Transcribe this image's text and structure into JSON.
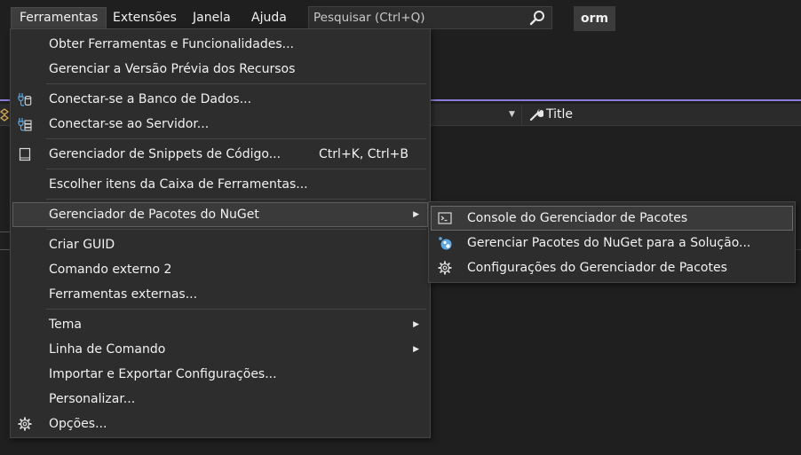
{
  "menubar": {
    "items": [
      {
        "label": "Ferramentas"
      },
      {
        "label": "Extensões"
      },
      {
        "label": "Janela"
      },
      {
        "label": "Ajuda"
      }
    ],
    "search_placeholder": "Pesquisar (Ctrl+Q)",
    "profile_badge": "orm"
  },
  "toolbar": {
    "title_label": "Title"
  },
  "tools_menu": {
    "items": [
      {
        "label": "Obter Ferramentas e Funcionalidades..."
      },
      {
        "label": "Gerenciar a Versão Prévia dos Recursos"
      },
      {
        "label": "Conectar-se a Banco de Dados...",
        "icon": "database-connect-icon"
      },
      {
        "label": "Conectar-se ao Servidor...",
        "icon": "server-connect-icon"
      },
      {
        "label": "Gerenciador de Snippets de Código...",
        "shortcut": "Ctrl+K, Ctrl+B",
        "icon": "snippet-icon"
      },
      {
        "label": "Escolher itens da Caixa de Ferramentas..."
      },
      {
        "label": "Gerenciador de Pacotes do NuGet",
        "submenu": true
      },
      {
        "label": "Criar GUID"
      },
      {
        "label": "Comando externo 2"
      },
      {
        "label": "Ferramentas externas..."
      },
      {
        "label": "Tema",
        "submenu": true
      },
      {
        "label": "Linha de Comando",
        "submenu": true
      },
      {
        "label": "Importar e Exportar Configurações..."
      },
      {
        "label": "Personalizar..."
      },
      {
        "label": "Opções...",
        "icon": "gear-icon"
      }
    ]
  },
  "nuget_submenu": {
    "items": [
      {
        "label": "Console do Gerenciador de Pacotes",
        "icon": "console-icon"
      },
      {
        "label": "Gerenciar Pacotes do NuGet para a Solução...",
        "icon": "nuget-icon"
      },
      {
        "label": "Configurações do Gerenciador de Pacotes",
        "icon": "gear-icon"
      }
    ]
  },
  "colors": {
    "background": "#1f1f1f",
    "menu_background": "#2d2d2d",
    "accent_line": "#8a7bd8",
    "nuget_blue": "#5aa9e6"
  }
}
